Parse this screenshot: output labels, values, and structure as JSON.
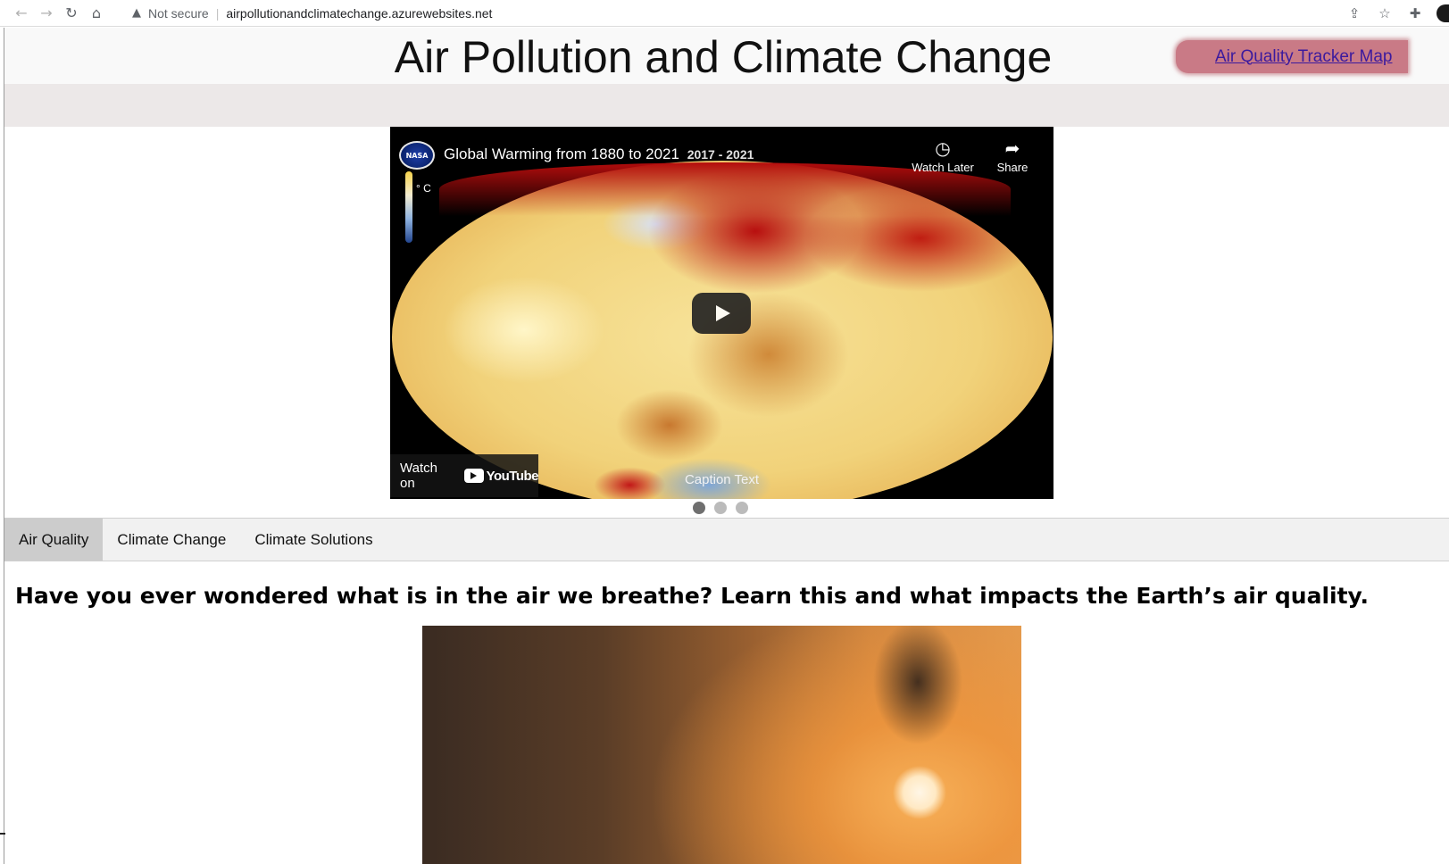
{
  "browser": {
    "security_label": "Not secure",
    "url": "airpollutionandclimatechange.azurewebsites.net"
  },
  "header": {
    "title": "Air Pollution and Climate Change",
    "tracker_link": "Air Quality Tracker Map"
  },
  "video": {
    "title": "Global Warming from 1880 to 2021",
    "years": "2017 - 2021",
    "legend_unit": "° C",
    "watch_later": "Watch Later",
    "share": "Share",
    "watch_on": "Watch on",
    "youtube": "YouTube",
    "caption": "Caption Text"
  },
  "slides": {
    "count": 3,
    "active": 0
  },
  "tabs": [
    {
      "label": "Air Quality",
      "active": true
    },
    {
      "label": "Climate Change",
      "active": false
    },
    {
      "label": "Climate Solutions",
      "active": false
    }
  ],
  "main": {
    "headline": "Have you ever wondered what is in the air we breathe? Learn this and what impacts the Earth’s air quality."
  },
  "colors": {
    "tracker_button": "#c97a86",
    "active_tab": "#cccccc",
    "link": "#3b1a9e"
  }
}
